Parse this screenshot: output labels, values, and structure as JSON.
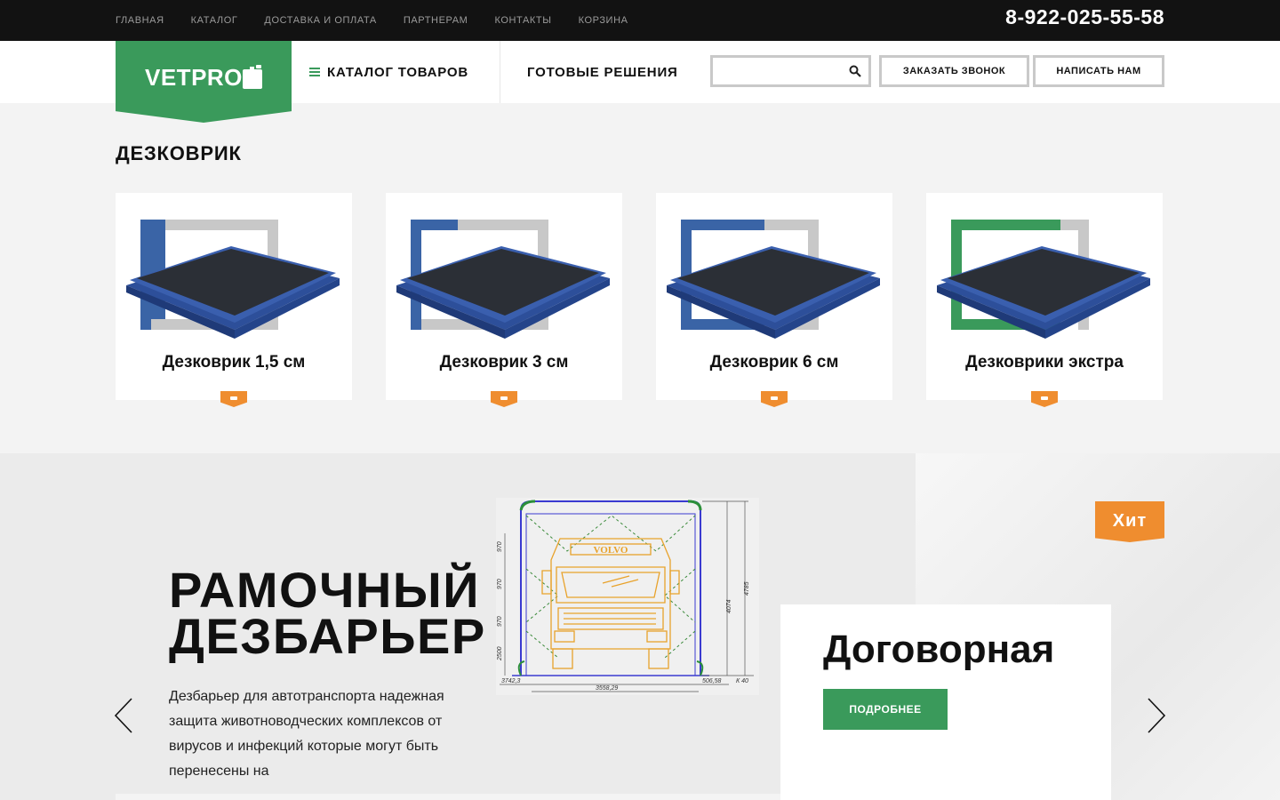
{
  "topnav": {
    "items": [
      "Главная",
      "Каталог",
      "Доставка и оплата",
      "Партнерам",
      "Контакты",
      "Корзина"
    ],
    "phone": "8-922-025-55-58"
  },
  "header": {
    "logo_text": "VETPRO",
    "catalog_label": "Каталог товаров",
    "solutions_label": "Готовые решения",
    "search_placeholder": "",
    "call_button": "Заказать звонок",
    "write_button": "Написать нам"
  },
  "section": {
    "title": "Дезковрик",
    "cards": [
      {
        "title": "Дезковрик 1,5 см",
        "accent": "#3a64a6"
      },
      {
        "title": "Дезковрик 3 см",
        "accent": "#3a64a6"
      },
      {
        "title": "Дезковрик 6 см",
        "accent": "#3a64a6"
      },
      {
        "title": "Дезковрики экстра",
        "accent": "#3a9a5b"
      }
    ]
  },
  "banner": {
    "title_line1": "Рамочный",
    "title_line2": "дезбарьер",
    "description": "Дезбарьер для автотранспорта надежная защита животноводческих комплексов от вирусов и инфекций которые могут быть перенесены на",
    "price": "Договорная",
    "more_button": "Подробнее",
    "badge": "Хит",
    "truck_brand": "VOLVO",
    "drawing_dims": [
      "970",
      "970",
      "970",
      "2500",
      "3742,3",
      "4785",
      "4074",
      "506,58",
      "3558,29",
      "К 40"
    ]
  },
  "colors": {
    "brand_green": "#3a9a5b",
    "badge_orange": "#ef8d2f",
    "mat_blue": "#3a64a6",
    "topbar": "#121212"
  }
}
